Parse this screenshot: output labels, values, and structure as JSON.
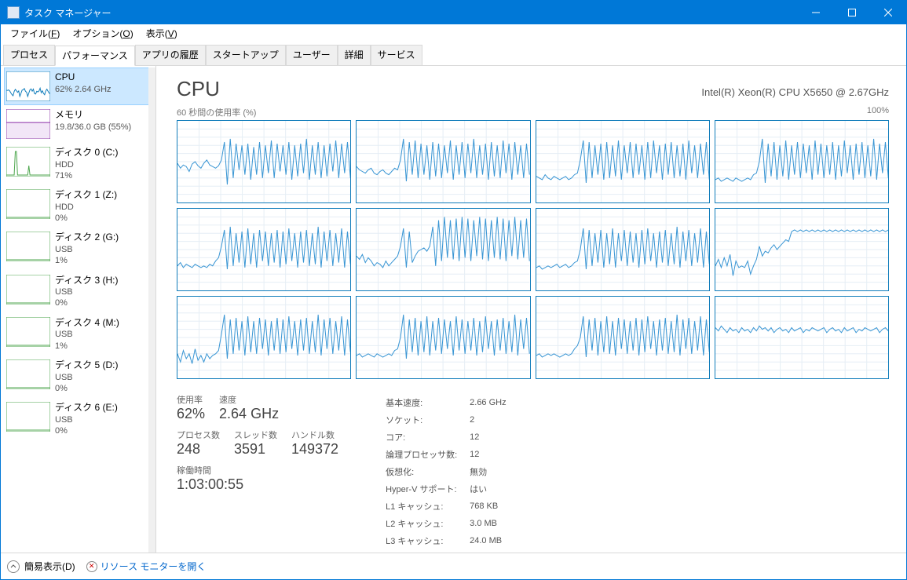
{
  "title": "タスク マネージャー",
  "menu": {
    "file": "ファイル(F)",
    "options": "オプション(O)",
    "view": "表示(V)"
  },
  "tabs": [
    "プロセス",
    "パフォーマンス",
    "アプリの履歴",
    "スタートアップ",
    "ユーザー",
    "詳細",
    "サービス"
  ],
  "activeTab": 1,
  "sidebar": [
    {
      "title": "CPU",
      "sub": "62%  2.64 GHz",
      "color": "#117dbb",
      "spark": "cpu"
    },
    {
      "title": "メモリ",
      "sub": "19.8/36.0 GB (55%)",
      "color": "#8a2da6",
      "spark": "mem"
    },
    {
      "title": "ディスク 0 (C:)",
      "sub1": "HDD",
      "sub2": "71%",
      "color": "#4ca64c",
      "spark": "disk0"
    },
    {
      "title": "ディスク 1 (Z:)",
      "sub1": "HDD",
      "sub2": "0%",
      "color": "#4ca64c",
      "spark": "low"
    },
    {
      "title": "ディスク 2 (G:)",
      "sub1": "USB",
      "sub2": "1%",
      "color": "#4ca64c",
      "spark": "low"
    },
    {
      "title": "ディスク 3 (H:)",
      "sub1": "USB",
      "sub2": "0%",
      "color": "#4ca64c",
      "spark": "low"
    },
    {
      "title": "ディスク 4 (M:)",
      "sub1": "USB",
      "sub2": "1%",
      "color": "#4ca64c",
      "spark": "low"
    },
    {
      "title": "ディスク 5 (D:)",
      "sub1": "USB",
      "sub2": "0%",
      "color": "#4ca64c",
      "spark": "low"
    },
    {
      "title": "ディスク 6 (E:)",
      "sub1": "USB",
      "sub2": "0%",
      "color": "#4ca64c",
      "spark": "low"
    }
  ],
  "header": {
    "title": "CPU",
    "sub": "Intel(R) Xeon(R) CPU X5650 @ 2.67GHz"
  },
  "chartLabels": {
    "left": "60 秒間の使用率 (%)",
    "right": "100%"
  },
  "chart_data": {
    "type": "line",
    "title": "CPU",
    "xlabel": "60 秒間の使用率 (%)",
    "ylabel": "",
    "ylim": [
      0,
      100
    ],
    "x_seconds": 60,
    "cores": 12,
    "series": [
      {
        "name": "Core 0",
        "values": [
          48,
          42,
          46,
          44,
          38,
          47,
          50,
          45,
          42,
          48,
          52,
          46,
          44,
          42,
          45,
          52,
          74,
          22,
          78,
          30,
          72,
          40,
          70,
          34,
          72,
          28,
          68,
          34,
          74,
          30,
          70,
          36,
          76,
          30,
          72,
          38,
          70,
          34,
          74,
          28,
          70,
          32,
          72,
          36,
          78,
          28,
          70,
          34,
          74,
          30,
          70,
          32,
          72,
          38,
          76,
          30,
          72,
          36,
          74,
          30
        ]
      },
      {
        "name": "Core 1",
        "values": [
          44,
          40,
          38,
          36,
          40,
          42,
          36,
          34,
          38,
          40,
          36,
          34,
          38,
          42,
          40,
          52,
          78,
          26,
          74,
          34,
          76,
          30,
          72,
          34,
          70,
          28,
          74,
          32,
          72,
          30,
          70,
          36,
          76,
          28,
          70,
          34,
          74,
          30,
          72,
          36,
          78,
          30,
          70,
          34,
          72,
          28,
          74,
          32,
          70,
          30,
          76,
          36,
          72,
          28,
          74,
          34,
          70,
          30,
          72,
          34
        ]
      },
      {
        "name": "Core 2",
        "values": [
          32,
          30,
          28,
          34,
          30,
          28,
          32,
          30,
          28,
          30,
          32,
          28,
          30,
          34,
          36,
          52,
          76,
          24,
          74,
          30,
          70,
          34,
          72,
          28,
          74,
          30,
          70,
          32,
          76,
          28,
          70,
          36,
          74,
          30,
          72,
          34,
          70,
          28,
          74,
          30,
          76,
          36,
          70,
          28,
          72,
          34,
          74,
          30,
          70,
          32,
          72,
          28,
          76,
          36,
          70,
          30,
          72,
          34,
          74,
          28
        ]
      },
      {
        "name": "Core 3",
        "values": [
          28,
          30,
          26,
          28,
          30,
          28,
          26,
          30,
          28,
          26,
          28,
          30,
          28,
          34,
          36,
          50,
          78,
          24,
          72,
          32,
          74,
          28,
          70,
          32,
          76,
          28,
          70,
          34,
          74,
          30,
          72,
          36,
          70,
          28,
          76,
          34,
          72,
          30,
          70,
          34,
          74,
          28,
          70,
          32,
          76,
          36,
          70,
          28,
          72,
          34,
          74,
          30,
          70,
          32,
          78,
          28,
          72,
          36,
          74,
          30
        ]
      },
      {
        "name": "Core 4",
        "values": [
          30,
          34,
          28,
          32,
          30,
          28,
          32,
          30,
          28,
          30,
          28,
          32,
          30,
          36,
          40,
          54,
          74,
          26,
          78,
          30,
          70,
          34,
          72,
          28,
          76,
          32,
          70,
          28,
          74,
          36,
          72,
          30,
          70,
          34,
          74,
          28,
          72,
          32,
          76,
          36,
          70,
          28,
          72,
          34,
          74,
          30,
          70,
          32,
          78,
          28,
          72,
          36,
          74,
          30,
          70,
          34,
          76,
          28,
          72,
          32
        ]
      },
      {
        "name": "Core 5",
        "values": [
          42,
          38,
          44,
          34,
          40,
          36,
          30,
          34,
          32,
          28,
          36,
          30,
          34,
          38,
          42,
          54,
          76,
          28,
          72,
          34,
          42,
          48,
          50,
          52,
          48,
          54,
          78,
          30,
          86,
          36,
          90,
          40,
          86,
          38,
          88,
          36,
          90,
          40,
          88,
          36,
          86,
          42,
          90,
          38,
          88,
          36,
          86,
          40,
          90,
          38,
          88,
          36,
          86,
          42,
          90,
          38,
          86,
          40,
          88,
          36
        ]
      },
      {
        "name": "Core 6",
        "values": [
          28,
          30,
          26,
          28,
          30,
          28,
          30,
          32,
          28,
          30,
          32,
          28,
          30,
          34,
          36,
          50,
          76,
          26,
          74,
          30,
          70,
          34,
          74,
          28,
          70,
          32,
          76,
          28,
          70,
          36,
          74,
          30,
          72,
          34,
          70,
          28,
          74,
          32,
          76,
          36,
          70,
          28,
          72,
          34,
          74,
          30,
          70,
          32,
          78,
          28,
          72,
          36,
          74,
          30,
          70,
          34,
          76,
          28,
          72,
          32
        ]
      },
      {
        "name": "Core 7",
        "values": [
          30,
          38,
          28,
          40,
          30,
          44,
          18,
          36,
          28,
          30,
          28,
          36,
          20,
          30,
          38,
          54,
          42,
          48,
          46,
          52,
          56,
          50,
          54,
          58,
          62,
          60,
          72,
          74,
          72,
          74,
          72,
          74,
          72,
          74,
          72,
          74,
          72,
          74,
          72,
          74,
          72,
          74,
          72,
          74,
          72,
          74,
          72,
          74,
          72,
          74,
          72,
          74,
          72,
          74,
          72,
          74,
          72,
          74,
          72,
          74
        ]
      },
      {
        "name": "Core 8",
        "values": [
          30,
          20,
          34,
          24,
          30,
          18,
          36,
          22,
          28,
          20,
          30,
          24,
          28,
          30,
          34,
          54,
          78,
          24,
          72,
          30,
          74,
          34,
          70,
          28,
          76,
          32,
          70,
          30,
          74,
          36,
          72,
          28,
          70,
          34,
          74,
          30,
          72,
          32,
          76,
          36,
          70,
          28,
          72,
          34,
          74,
          30,
          70,
          32,
          78,
          28,
          72,
          36,
          74,
          30,
          70,
          34,
          76,
          28,
          72,
          32
        ]
      },
      {
        "name": "Core 9",
        "values": [
          28,
          30,
          26,
          28,
          30,
          28,
          26,
          30,
          28,
          26,
          28,
          30,
          28,
          34,
          36,
          50,
          78,
          24,
          72,
          32,
          74,
          28,
          70,
          32,
          76,
          28,
          70,
          34,
          74,
          30,
          72,
          36,
          70,
          28,
          76,
          34,
          72,
          30,
          70,
          34,
          74,
          28,
          70,
          32,
          76,
          36,
          70,
          28,
          72,
          34,
          74,
          30,
          70,
          32,
          78,
          28,
          72,
          36,
          74,
          30
        ]
      },
      {
        "name": "Core 10",
        "values": [
          28,
          30,
          26,
          28,
          30,
          28,
          30,
          28,
          26,
          28,
          30,
          28,
          30,
          36,
          40,
          50,
          76,
          26,
          72,
          34,
          74,
          28,
          70,
          32,
          76,
          30,
          70,
          28,
          74,
          36,
          72,
          30,
          70,
          34,
          74,
          28,
          72,
          32,
          76,
          36,
          70,
          28,
          72,
          34,
          74,
          30,
          70,
          32,
          78,
          28,
          72,
          36,
          74,
          30,
          70,
          34,
          76,
          28,
          72,
          32
        ]
      },
      {
        "name": "Core 11",
        "values": [
          62,
          58,
          64,
          60,
          56,
          62,
          58,
          60,
          56,
          62,
          58,
          60,
          56,
          62,
          58,
          64,
          60,
          62,
          58,
          62,
          56,
          60,
          62,
          58,
          60,
          56,
          62,
          58,
          60,
          62,
          56,
          60,
          58,
          62,
          60,
          58,
          60,
          62,
          56,
          60,
          62,
          58,
          60,
          56,
          62,
          58,
          60,
          62,
          56,
          60,
          58,
          62,
          60,
          58,
          60,
          62,
          56,
          60,
          62,
          58
        ]
      }
    ]
  },
  "stats": {
    "left": [
      [
        {
          "label": "使用率",
          "value": "62%"
        },
        {
          "label": "速度",
          "value": "2.64 GHz"
        }
      ],
      [
        {
          "label": "プロセス数",
          "value": "248"
        },
        {
          "label": "スレッド数",
          "value": "3591"
        },
        {
          "label": "ハンドル数",
          "value": "149372"
        }
      ],
      [
        {
          "label": "稼働時間",
          "value": "1:03:00:55"
        }
      ]
    ],
    "right": [
      [
        "基本速度:",
        "2.66 GHz"
      ],
      [
        "ソケット:",
        "2"
      ],
      [
        "コア:",
        "12"
      ],
      [
        "論理プロセッサ数:",
        "12"
      ],
      [
        "仮想化:",
        "無効"
      ],
      [
        "Hyper-V サポート:",
        "はい"
      ],
      [
        "L1 キャッシュ:",
        "768 KB"
      ],
      [
        "L2 キャッシュ:",
        "3.0 MB"
      ],
      [
        "L3 キャッシュ:",
        "24.0 MB"
      ]
    ]
  },
  "statusbar": {
    "simple": "簡易表示(D)",
    "resmon": "リソース モニターを開く"
  }
}
